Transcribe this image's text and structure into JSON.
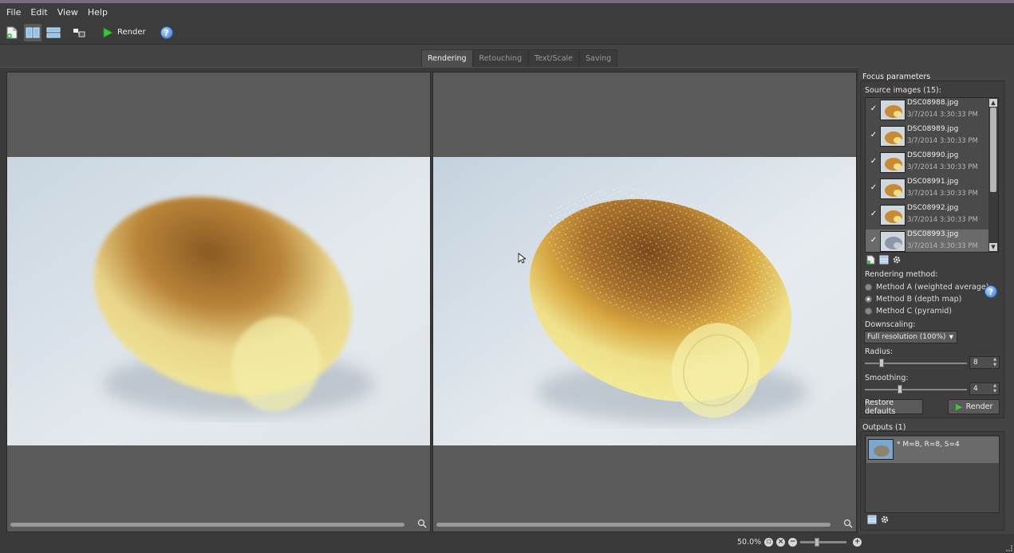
{
  "menu": [
    "File",
    "Edit",
    "View",
    "Help"
  ],
  "toolbar": {
    "render_label": "Render"
  },
  "tabs": [
    {
      "label": "Rendering",
      "active": true
    },
    {
      "label": "Retouching",
      "active": false
    },
    {
      "label": "Text/Scale",
      "active": false
    },
    {
      "label": "Saving",
      "active": false
    }
  ],
  "focus": {
    "title": "Focus parameters",
    "source_label": "Source images (15):",
    "sources": [
      {
        "name": "DSC08988.jpg",
        "date": "3/7/2014 3:30:33 PM",
        "checked": true
      },
      {
        "name": "DSC08989.jpg",
        "date": "3/7/2014 3:30:33 PM",
        "checked": true
      },
      {
        "name": "DSC08990.jpg",
        "date": "3/7/2014 3:30:33 PM",
        "checked": true
      },
      {
        "name": "DSC08991.jpg",
        "date": "3/7/2014 3:30:33 PM",
        "checked": true
      },
      {
        "name": "DSC08992.jpg",
        "date": "3/7/2014 3:30:33 PM",
        "checked": true
      },
      {
        "name": "DSC08993.jpg",
        "date": "3/7/2014 3:30:33 PM",
        "checked": true,
        "selected": true
      }
    ],
    "method_label": "Rendering method:",
    "methods": [
      {
        "label": "Method A (weighted average)",
        "selected": false
      },
      {
        "label": "Method B (depth map)",
        "selected": true
      },
      {
        "label": "Method C (pyramid)",
        "selected": false
      }
    ],
    "downscaling_label": "Downscaling:",
    "downscaling_value": "Full resolution (100%)",
    "radius_label": "Radius:",
    "radius_value": "8",
    "smoothing_label": "Smoothing:",
    "smoothing_value": "4",
    "restore_label": "Restore defaults",
    "render_label": "Render"
  },
  "outputs": {
    "title": "Outputs (1)",
    "items": [
      {
        "label": "* M=B, R=8, S=4"
      }
    ]
  },
  "status": {
    "zoom": "50.0%"
  },
  "colors": {
    "accent_green": "#3cc83c",
    "help_blue": "#3a7ad8"
  }
}
